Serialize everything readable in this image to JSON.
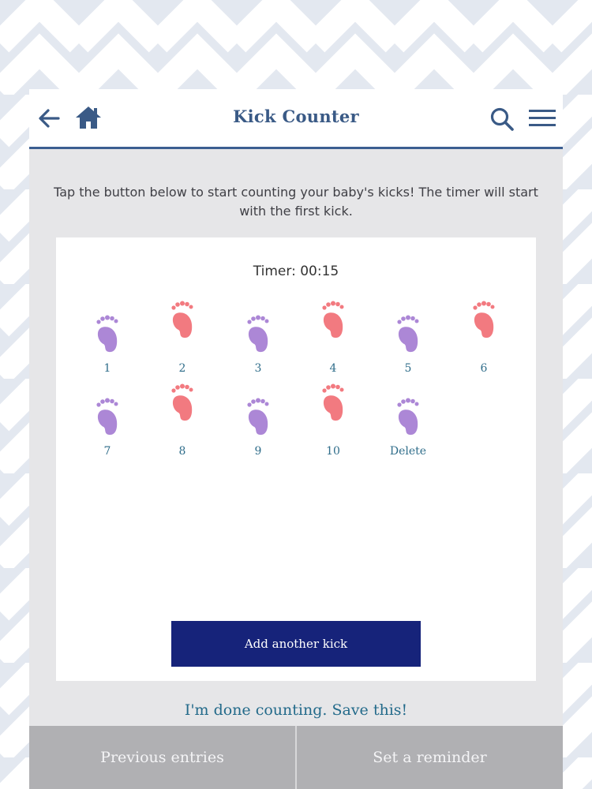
{
  "header": {
    "title": "Kick Counter",
    "icons": [
      "back-arrow-icon",
      "home-icon",
      "search-icon",
      "menu-icon"
    ]
  },
  "intro": "Tap the button below to start counting your baby's kicks! The timer will start with the first kick.",
  "timer": {
    "label": "Timer:",
    "value": "00:15"
  },
  "kicks": [
    {
      "label": "1",
      "color": "purple"
    },
    {
      "label": "2",
      "color": "coral"
    },
    {
      "label": "3",
      "color": "purple"
    },
    {
      "label": "4",
      "color": "coral"
    },
    {
      "label": "5",
      "color": "purple"
    },
    {
      "label": "6",
      "color": "coral"
    },
    {
      "label": "7",
      "color": "purple"
    },
    {
      "label": "8",
      "color": "coral"
    },
    {
      "label": "9",
      "color": "purple"
    },
    {
      "label": "10",
      "color": "coral"
    },
    {
      "label": "Delete",
      "color": "purple"
    }
  ],
  "add_button": "Add another kick",
  "done_link": "I'm done counting. Save this!",
  "bottom": {
    "previous": "Previous entries",
    "reminder": "Set a reminder"
  },
  "colors": {
    "purple": "#ac87d6",
    "coral": "#f27a80",
    "header_accent": "#3b5e91",
    "button": "#16237a",
    "link": "#236a8a"
  }
}
